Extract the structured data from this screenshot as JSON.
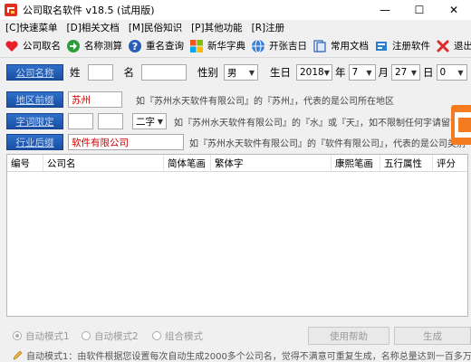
{
  "window": {
    "title": "公司取名软件 v18.5 (试用版)",
    "min": "—",
    "max": "☐",
    "close": "✕"
  },
  "menu": [
    "[C]快速菜单",
    "[D]相关文档",
    "[M]民俗知识",
    "[P]其他功能",
    "[R]注册"
  ],
  "toolbar": [
    {
      "label": "公司取名",
      "icon": "heart-icon"
    },
    {
      "label": "名称测算",
      "icon": "arrow-right-icon"
    },
    {
      "label": "重名查询",
      "icon": "question-icon"
    },
    {
      "label": "新华字典",
      "icon": "windows-logo-icon"
    },
    {
      "label": "开张吉日",
      "icon": "globe-icon"
    },
    {
      "label": "常用文档",
      "icon": "document-icon"
    },
    {
      "label": "注册软件",
      "icon": "register-icon"
    },
    {
      "label": "退出",
      "icon": "close-x-icon"
    }
  ],
  "form": {
    "name_btn": "公司名称",
    "surname_label": "姓",
    "surname_value": "",
    "given_label": "名",
    "given_value": "",
    "gender_label": "性别",
    "gender_value": "男",
    "birthday_label": "生日",
    "year_value": "2018",
    "year_unit": "年",
    "month_value": "7",
    "month_unit": "月",
    "day_value": "27",
    "day_unit": "日",
    "hour_value": "0",
    "region_btn": "地区前缀",
    "region_value": "苏州",
    "region_hint": "如『苏州水天软件有限公司』的『苏州』，代表的是公司所在地区",
    "char_btn": "字词限定",
    "char_value1": "",
    "char_value2": "",
    "char_count": "二字",
    "char_hint": "如『苏州水天软件有限公司』的『水』或『天』，如不限制任何字请留空",
    "industry_btn": "行业后缀",
    "industry_value": "软件有限公司",
    "industry_hint": "如『苏州水天软件有限公司』的『软件有限公司』，代表的是公司类别"
  },
  "table": {
    "columns": [
      "编号",
      "公司名",
      "简体笔画",
      "繁体字",
      "康熙笔画",
      "五行属性",
      "评分"
    ]
  },
  "bottom": {
    "radio1": "自动模式1",
    "radio2": "自动模式2",
    "radio3": "组合模式",
    "help_btn": "使用帮助",
    "generate_btn": "生成"
  },
  "status": "自动模式1：由软件根据您设置每次自动生成2000多个公司名，觉得不满意可重复生成，名称总量达到一百多万个。"
}
